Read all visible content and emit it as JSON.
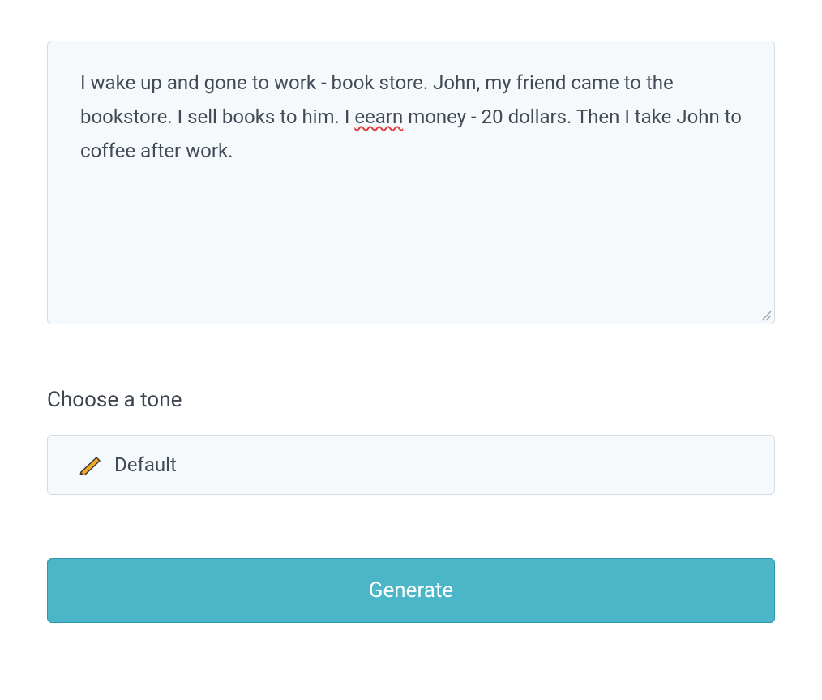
{
  "input": {
    "text_before_error": "I wake up and gone to work - book store. John, my friend came to the bookstore. I sell books to him. I ",
    "error_word": "eearn",
    "text_after_error": " money - 20 dollars. Then I take John to coffee after work."
  },
  "tone": {
    "section_label": "Choose a tone",
    "selected": "Default",
    "icon": "pencil-icon"
  },
  "actions": {
    "generate_label": "Generate"
  }
}
